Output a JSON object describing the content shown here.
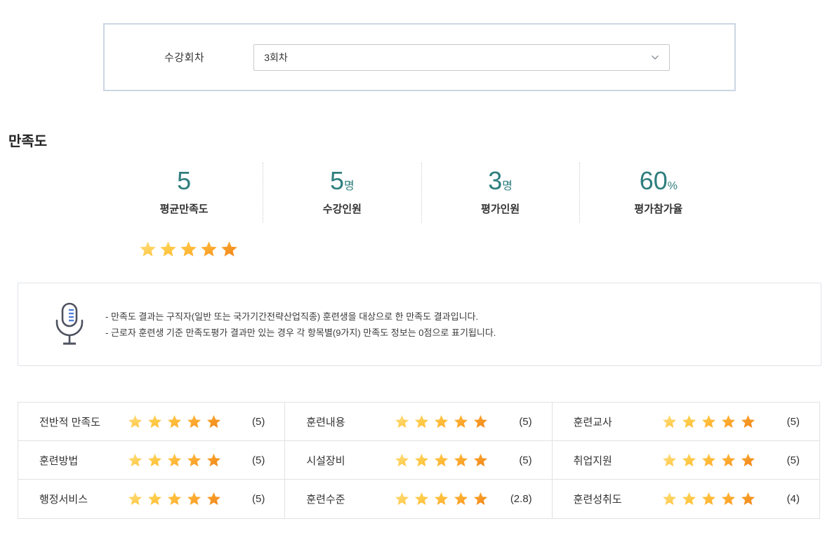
{
  "selector": {
    "label": "수강회차",
    "value": "3회차"
  },
  "section": {
    "title": "만족도"
  },
  "stats": [
    {
      "value": "5",
      "unit": "",
      "label": "평균만족도"
    },
    {
      "value": "5",
      "unit": "명",
      "label": "수강인원"
    },
    {
      "value": "3",
      "unit": "명",
      "label": "평가인원"
    },
    {
      "value": "60",
      "unit": "%",
      "label": "평가참가율"
    }
  ],
  "average_rating": {
    "stars": 5
  },
  "notice": {
    "lines": [
      "- 만족도 결과는 구직자(일반 또는 국가기간전략산업직종) 훈련생을 대상으로 한 만족도 결과입니다.",
      "- 근로자 훈련생 기준 만족도평가 결과만 있는 경우 각 항목별(9가지) 만족도 정보는 0점으로 표기됩니다."
    ]
  },
  "ratings_table": {
    "rows": [
      [
        {
          "label": "전반적 만족도",
          "stars": 5,
          "value": "(5)"
        },
        {
          "label": "훈련내용",
          "stars": 5,
          "value": "(5)"
        },
        {
          "label": "훈련교사",
          "stars": 5,
          "value": "(5)"
        }
      ],
      [
        {
          "label": "훈련방법",
          "stars": 5,
          "value": "(5)"
        },
        {
          "label": "시설장비",
          "stars": 5,
          "value": "(5)"
        },
        {
          "label": "취업지원",
          "stars": 5,
          "value": "(5)"
        }
      ],
      [
        {
          "label": "행정서비스",
          "stars": 5,
          "value": "(5)"
        },
        {
          "label": "훈련수준",
          "stars": 5,
          "value": "(2.8)"
        },
        {
          "label": "훈련성취도",
          "stars": 5,
          "value": "(4)"
        }
      ]
    ]
  },
  "icons": {
    "dropdown": "chevron-down-icon",
    "notice": "microphone-icon",
    "rating": "star-icon"
  },
  "colors": {
    "stat_accent": "#2f7e7e",
    "selector_border": "#ccd7e3",
    "table_border": "#e2e2e2",
    "notice_border": "#dfe3e8",
    "mic_outline": "#4e5260",
    "mic_lines": "#4f7fd9",
    "star_gradient": [
      [
        "#ffe082",
        "#ffc94a"
      ],
      [
        "#ffd65e",
        "#ffc13b"
      ],
      [
        "#ffca47",
        "#ffb232"
      ],
      [
        "#ffba39",
        "#fb9f28"
      ],
      [
        "#fba92e",
        "#f28b1e"
      ]
    ]
  }
}
